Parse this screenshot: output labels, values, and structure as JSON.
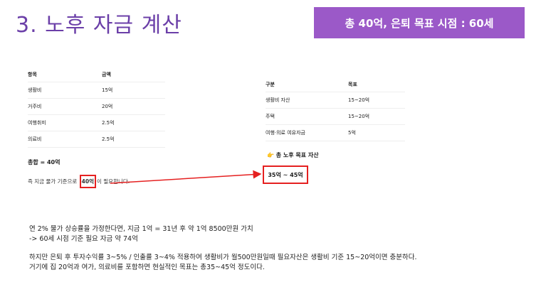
{
  "slide": {
    "title": "3. 노후 자금 계산",
    "summary": "총 40억, 은퇴 목표 시점  : 60세"
  },
  "cost_table": {
    "headers": [
      "항목",
      "금액"
    ],
    "rows": [
      [
        "생활비",
        "15억"
      ],
      [
        "거주비",
        "20억"
      ],
      [
        "여행취미",
        "2.5억"
      ],
      [
        "의료비",
        "2.5억"
      ]
    ]
  },
  "total": "총합 = 40억",
  "current_price": {
    "prefix": "즉 지금 물가 기준으로 ",
    "highlight": "40억",
    "suffix": "이 필요합니다."
  },
  "goal_table": {
    "headers": [
      "구분",
      "목표"
    ],
    "rows": [
      [
        "생활비 자산",
        "15~20억"
      ],
      [
        "주택",
        "15~20억"
      ],
      [
        "여행·의료 여유자금",
        "5억"
      ]
    ]
  },
  "goal": {
    "icon": "pointing-hand-icon",
    "icon_glyph": "👉",
    "heading": "총 노후 목표 자산",
    "value": "35억 ~ 45억"
  },
  "notes": [
    "연 2% 물가 상승률을 가정한다면, 지금 1억 = 31년 후 약 1억 8500만원 가치",
    "-> 60세 시점 기준 필요 자금 약 74억",
    "하지만 은퇴 후 투자수익률 3~5% / 인출률 3~4% 적용하여 생활비가 월500만원일때 필요자산은 생활비 기준 15~20억이면 충분하다.",
    "거기에 집 20억과 여가, 의료비를 포함하면 현실적인 목표는 총35~45억 정도이다."
  ],
  "colors": {
    "title": "#6b3fa8",
    "summary_bg": "#9b59c8",
    "highlight": "#e52020"
  }
}
